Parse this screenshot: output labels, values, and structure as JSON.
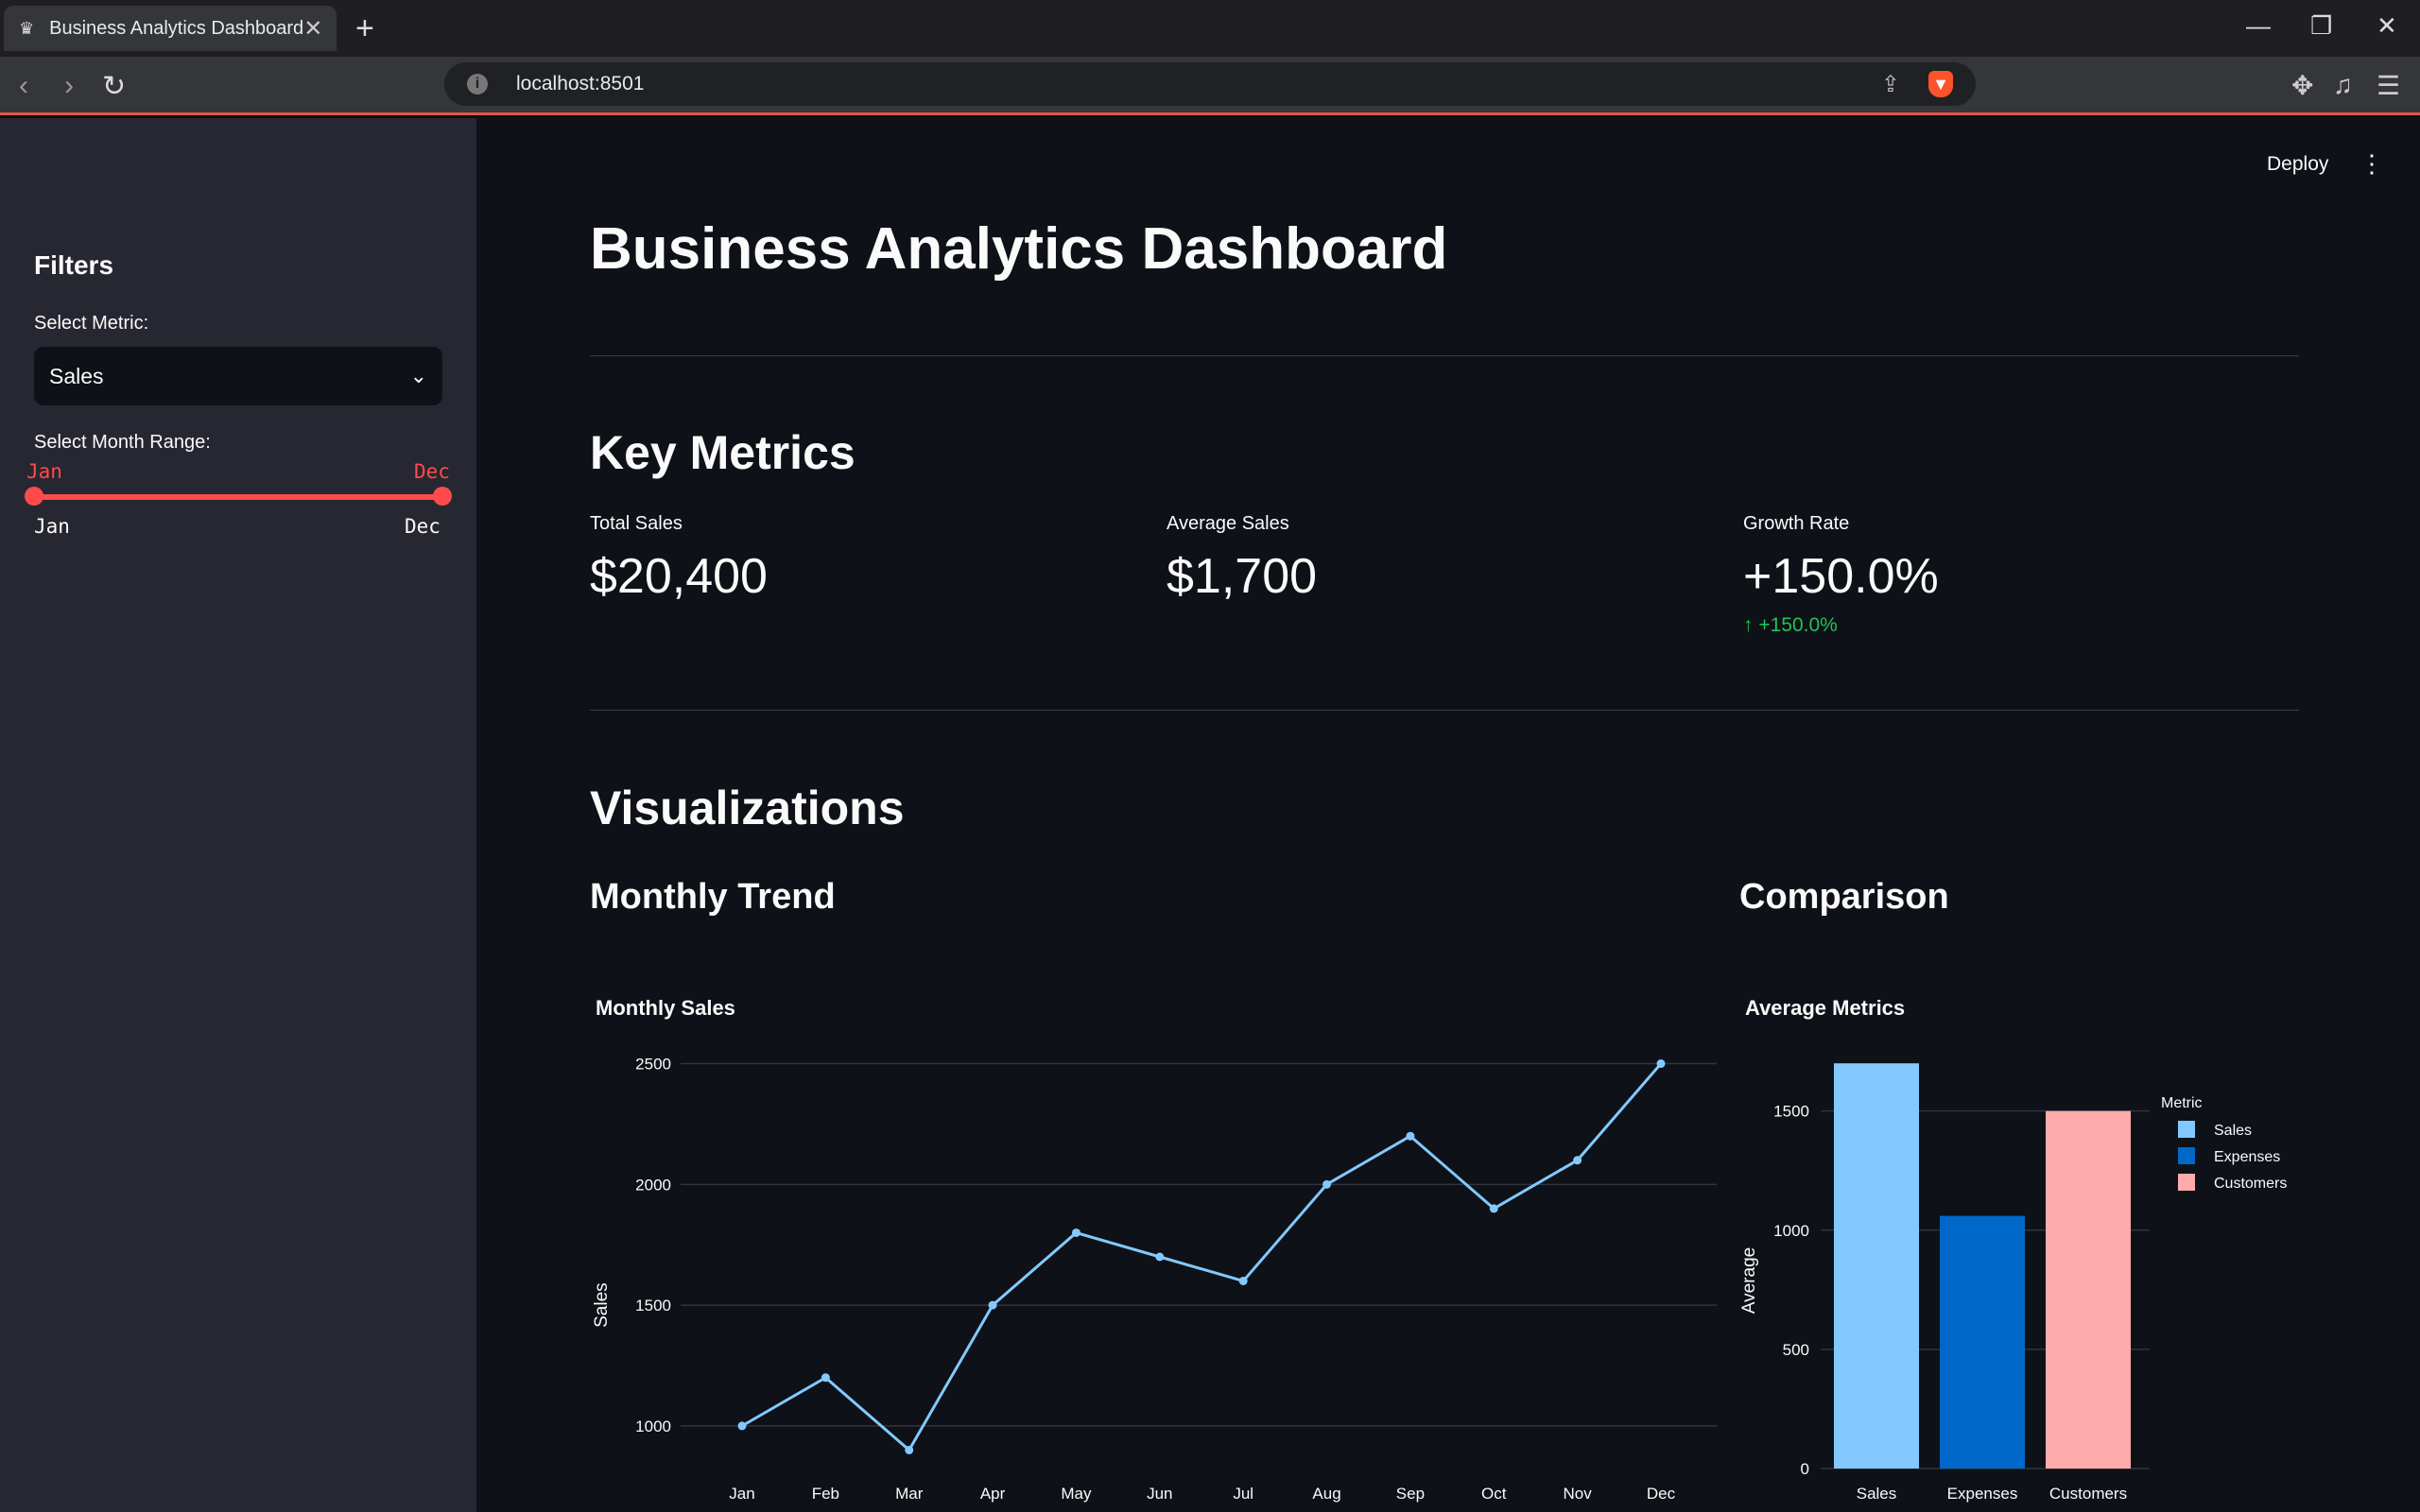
{
  "browser": {
    "tab_title": "Business Analytics Dashboard",
    "url": "localhost:8501"
  },
  "header": {
    "deploy_label": "Deploy"
  },
  "sidebar": {
    "title": "Filters",
    "metric_label": "Select Metric:",
    "metric_value": "Sales",
    "range_label": "Select Month Range:",
    "range_start": "Jan",
    "range_end": "Dec",
    "range_min_label": "Jan",
    "range_max_label": "Dec"
  },
  "main": {
    "title": "Business Analytics Dashboard",
    "key_metrics_heading": "Key Metrics",
    "metrics": [
      {
        "label": "Total Sales",
        "value": "$20,400"
      },
      {
        "label": "Average Sales",
        "value": "$1,700"
      },
      {
        "label": "Growth Rate",
        "value": "+150.0%",
        "delta": "+150.0%"
      }
    ],
    "visualizations_heading": "Visualizations",
    "trend_heading": "Monthly Trend",
    "comparison_heading": "Comparison"
  },
  "colors": {
    "accent": "#ff4b4b",
    "line": "#83c9ff",
    "bar_sales": "#83c9ff",
    "bar_expenses": "#0068c9",
    "bar_customers": "#ffabab",
    "delta_positive": "#21c354"
  },
  "chart_data": [
    {
      "type": "line",
      "title": "Monthly Sales",
      "ylabel": "Sales",
      "xlabel": "",
      "categories": [
        "Jan",
        "Feb",
        "Mar",
        "Apr",
        "May",
        "Jun",
        "Jul",
        "Aug",
        "Sep",
        "Oct",
        "Nov",
        "Dec"
      ],
      "values": [
        1000,
        1200,
        900,
        1500,
        1800,
        1700,
        1600,
        2000,
        2200,
        1900,
        2100,
        2500
      ],
      "yticks": [
        1000,
        1500,
        2000,
        2500
      ],
      "ylim": [
        800,
        2600
      ],
      "grid": true
    },
    {
      "type": "bar",
      "title": "Average Metrics",
      "ylabel": "Average",
      "categories": [
        "Sales",
        "Expenses",
        "Customers"
      ],
      "values": [
        1700,
        1060,
        1500
      ],
      "yticks": [
        0,
        500,
        1000,
        1500
      ],
      "ylim": [
        0,
        1800
      ],
      "legend_title": "Metric",
      "legend": [
        "Sales",
        "Expenses",
        "Customers"
      ],
      "legend_position": "top-right",
      "grid": true
    }
  ]
}
